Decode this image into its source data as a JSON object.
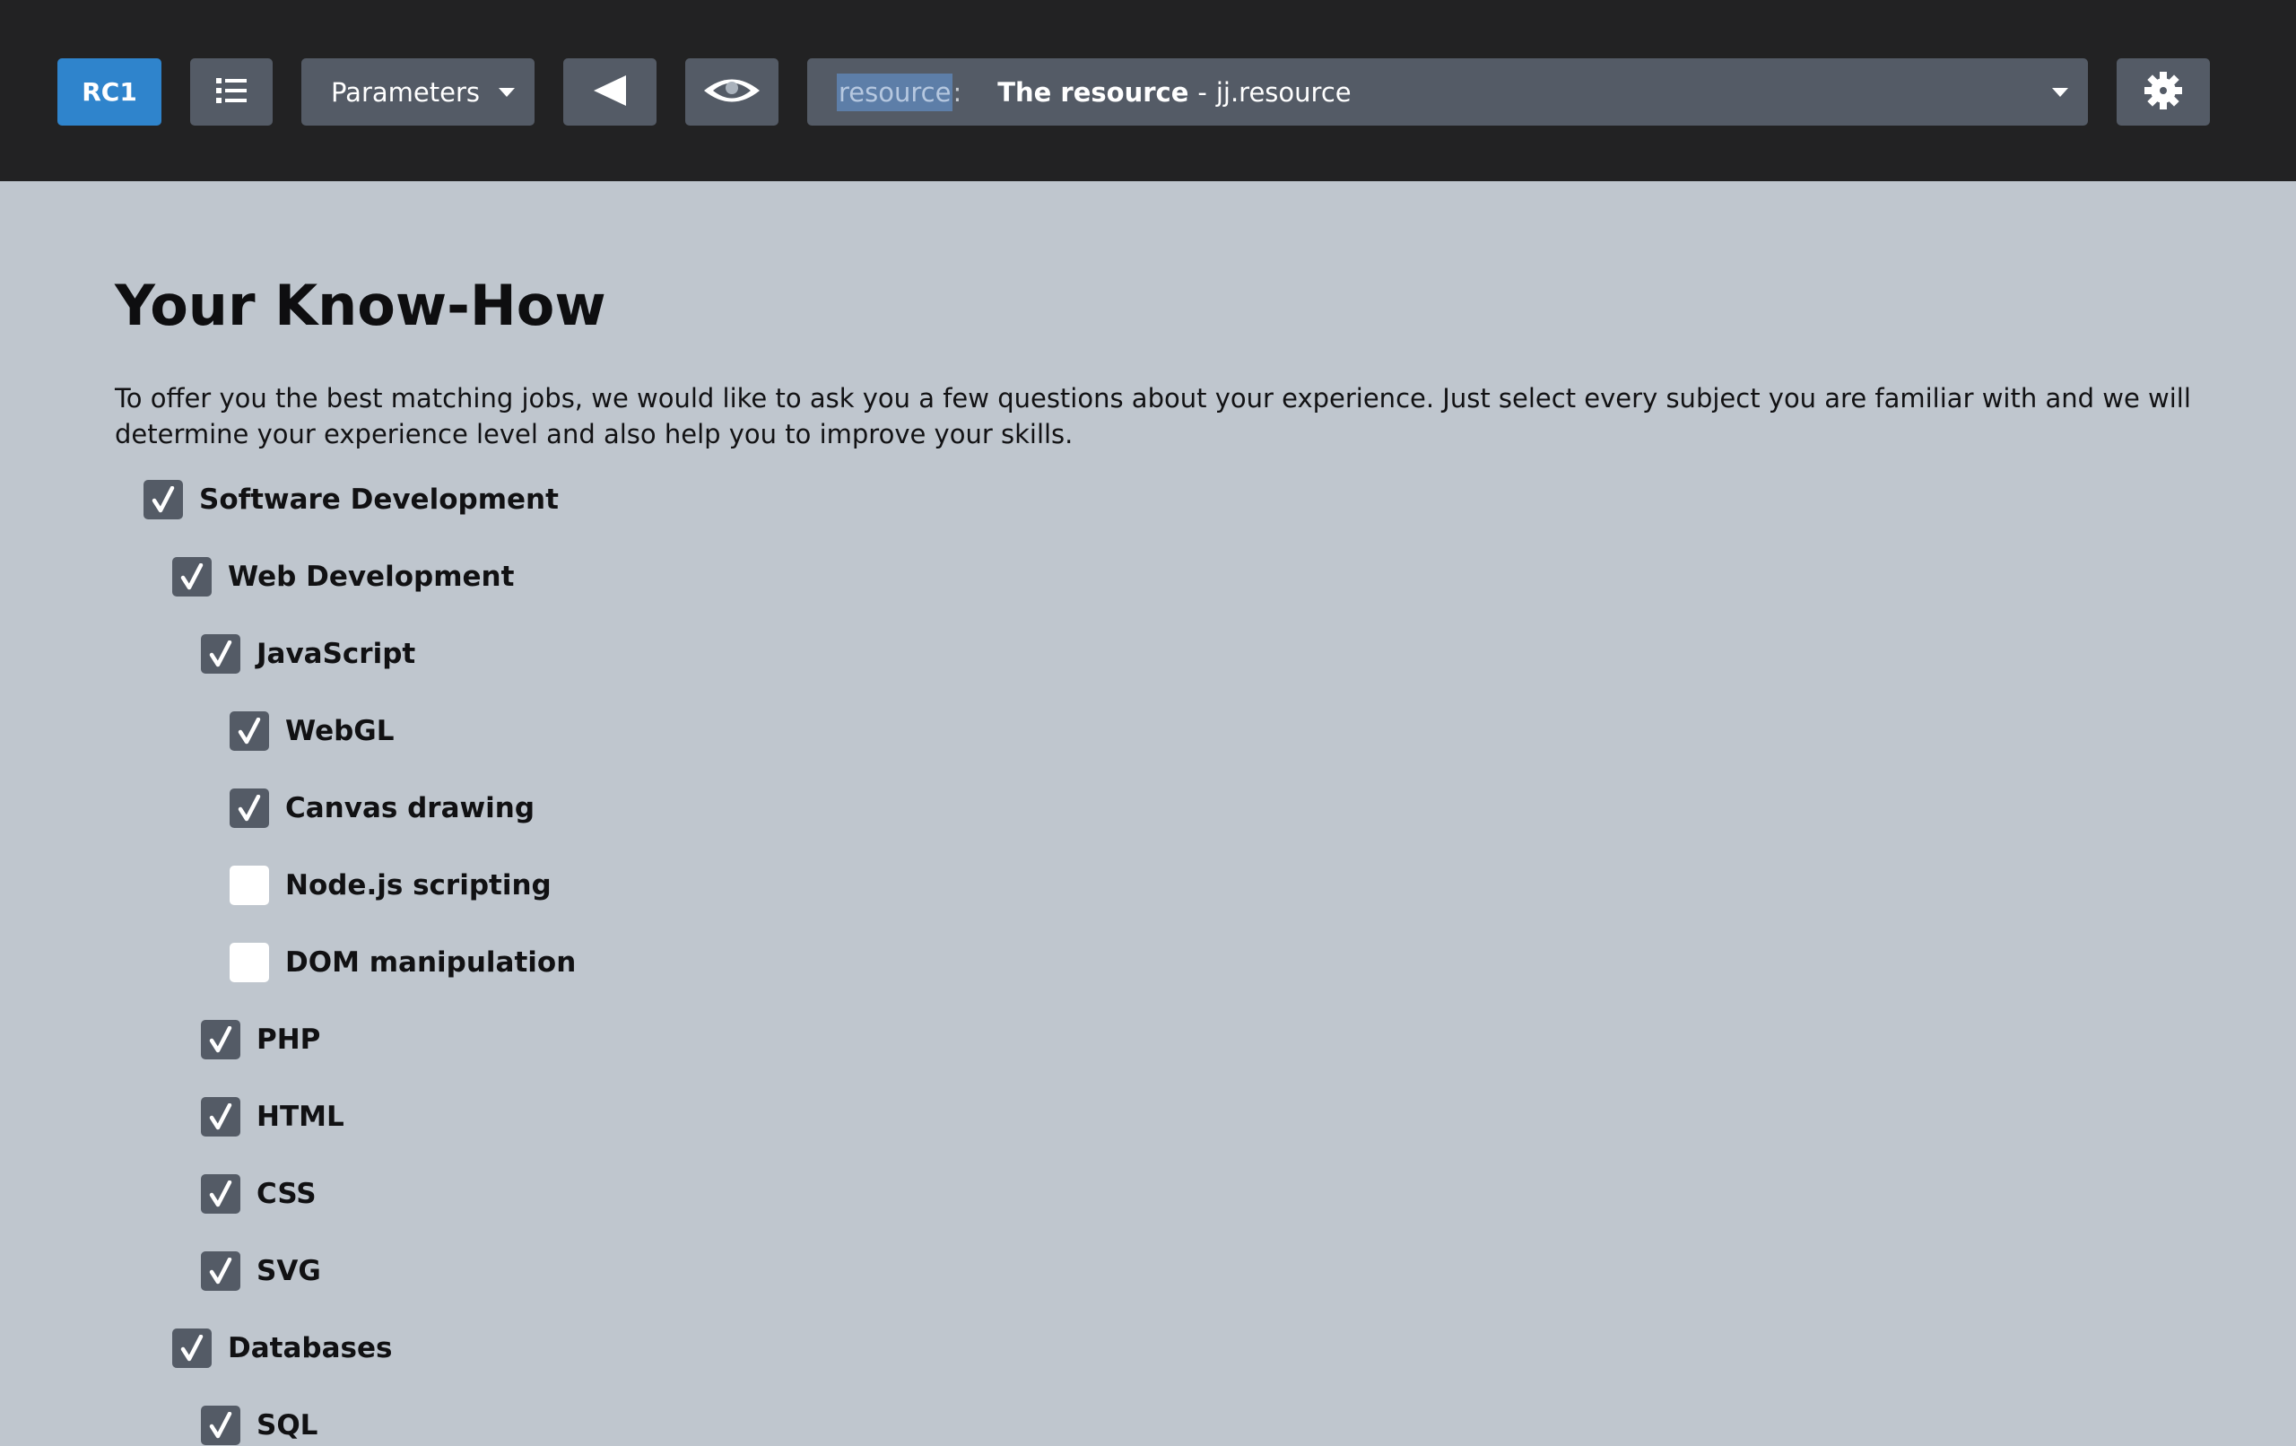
{
  "toolbar": {
    "rc_label": "RC1",
    "list_icon": "list-icon",
    "parameters_label": "Parameters",
    "back_icon": "back-triangle-icon",
    "preview_icon": "eye-icon",
    "resource": {
      "key": "resource",
      "colon": ":",
      "title": "The resource",
      "separator": "-",
      "path": "jj.resource"
    },
    "settings_icon": "gear-icon"
  },
  "page": {
    "title": "Your Know-How",
    "intro": "To offer you the best matching jobs, we would like to ask you a few questions about your experience. Just select every subject you are familiar with and we will determine your experience level and also help you to improve your skills."
  },
  "skills": [
    {
      "label": "Software Development",
      "level": 0,
      "checked": true
    },
    {
      "label": "Web Development",
      "level": 1,
      "checked": true
    },
    {
      "label": "JavaScript",
      "level": 2,
      "checked": true
    },
    {
      "label": "WebGL",
      "level": 3,
      "checked": true
    },
    {
      "label": "Canvas drawing",
      "level": 3,
      "checked": true
    },
    {
      "label": "Node.js scripting",
      "level": 3,
      "checked": false
    },
    {
      "label": "DOM manipulation",
      "level": 3,
      "checked": false
    },
    {
      "label": "PHP",
      "level": 2,
      "checked": true
    },
    {
      "label": "HTML",
      "level": 2,
      "checked": true
    },
    {
      "label": "CSS",
      "level": 2,
      "checked": true
    },
    {
      "label": "SVG",
      "level": 2,
      "checked": true
    },
    {
      "label": "Databases",
      "level": 1,
      "checked": true
    },
    {
      "label": "SQL",
      "level": 2,
      "checked": true
    }
  ],
  "colors": {
    "topbar": "#222223",
    "background": "#bfc6ce",
    "button": "#545b66",
    "accent": "#2f84cc"
  }
}
